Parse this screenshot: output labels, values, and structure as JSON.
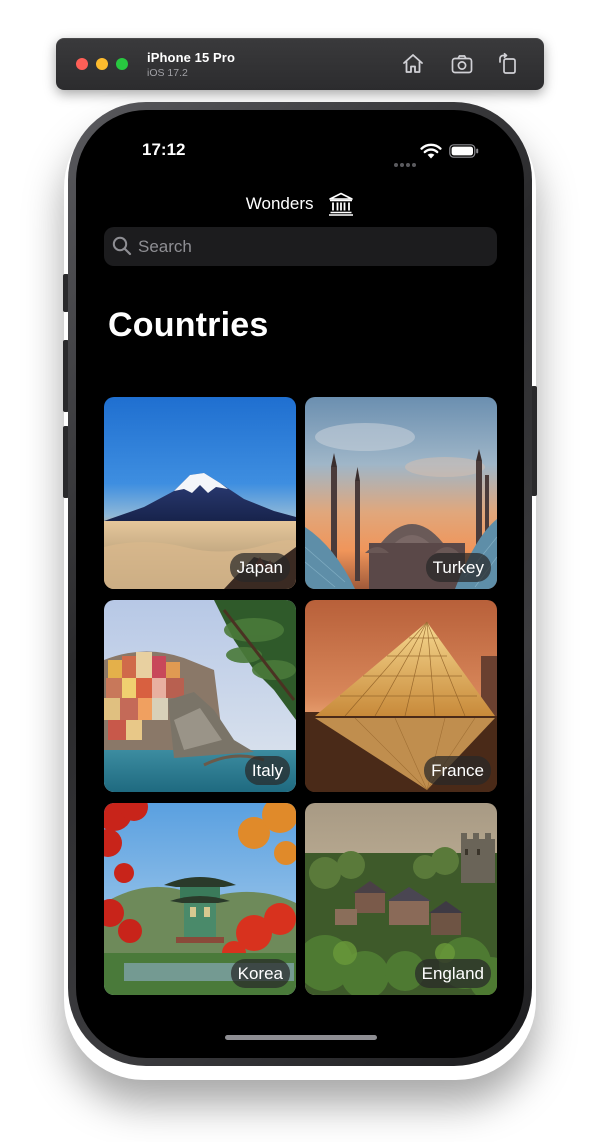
{
  "simulator": {
    "device_name": "iPhone 15 Pro",
    "os_version": "iOS 17.2",
    "buttons": [
      "home-icon",
      "screenshot-icon",
      "rotate-icon"
    ]
  },
  "status_bar": {
    "time": "17:12",
    "icons": [
      "cellular-icon",
      "wifi-icon",
      "battery-icon"
    ]
  },
  "nav": {
    "title": "Wonders",
    "title_icon": "museum-icon"
  },
  "search": {
    "placeholder": "Search",
    "icon": "magnifying-glass-icon"
  },
  "section_title": "Countries",
  "countries": [
    {
      "name": "Japan"
    },
    {
      "name": "Turkey"
    },
    {
      "name": "Italy"
    },
    {
      "name": "France"
    },
    {
      "name": "Korea"
    },
    {
      "name": "England"
    }
  ],
  "colors": {
    "background": "#000000",
    "search_field": "#1c1c1e",
    "placeholder": "#8e8e93",
    "label_pill": "#282828"
  }
}
